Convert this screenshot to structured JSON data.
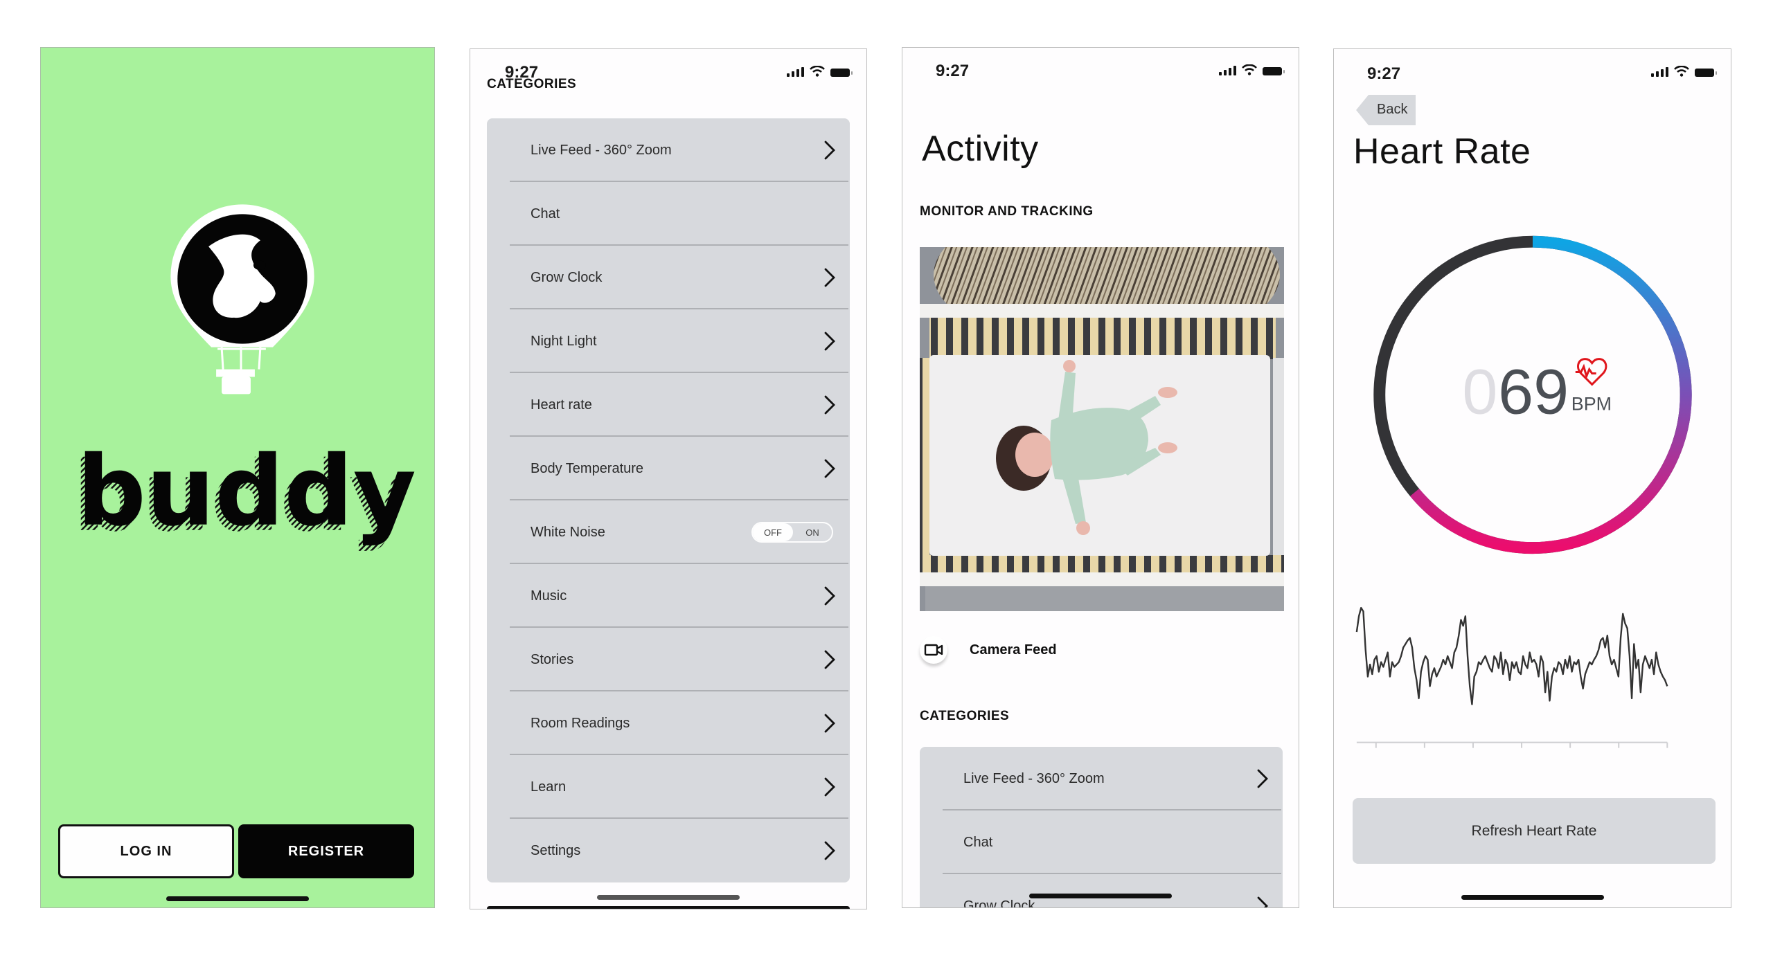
{
  "status_bar": {
    "time": "9:27"
  },
  "screens": {
    "welcome": {
      "brand": "buddy",
      "login_label": "LOG IN",
      "register_label": "REGISTER",
      "bg_color": "#a8f29c"
    },
    "categories": {
      "title": "CATEGORIES",
      "items": [
        {
          "label": "Live Feed - 360° Zoom",
          "control": "chevron"
        },
        {
          "label": "Chat",
          "control": "none"
        },
        {
          "label": "Grow Clock",
          "control": "chevron"
        },
        {
          "label": "Night Light",
          "control": "chevron"
        },
        {
          "label": "Heart rate",
          "control": "chevron"
        },
        {
          "label": "Body Temperature",
          "control": "chevron"
        },
        {
          "label": "White Noise",
          "control": "toggle",
          "toggle": {
            "off_label": "OFF",
            "on_label": "ON",
            "state": "off"
          }
        },
        {
          "label": "Music",
          "control": "chevron"
        },
        {
          "label": "Stories",
          "control": "chevron"
        },
        {
          "label": "Room Readings",
          "control": "chevron"
        },
        {
          "label": "Learn",
          "control": "chevron"
        },
        {
          "label": "Settings",
          "control": "chevron"
        }
      ]
    },
    "activity": {
      "title": "Activity",
      "monitor_heading": "MONITOR AND TRACKING",
      "camera_feed_label": "Camera Feed",
      "camera_icon": "video-camera-icon",
      "categories_heading": "CATEGORIES",
      "items": [
        {
          "label": "Live Feed - 360° Zoom",
          "control": "chevron"
        },
        {
          "label": "Chat",
          "control": "none"
        },
        {
          "label": "Grow Clock",
          "control": "chevron"
        }
      ]
    },
    "heart_rate": {
      "back_label": "Back",
      "title": "Heart Rate",
      "bpm_leading": "0",
      "bpm_value": "69",
      "bpm_unit": "BPM",
      "gauge_fraction": 0.64,
      "gauge_colors": {
        "start": "#0ea5e4",
        "mid": "#7b4fb6",
        "end": "#ec0d6d",
        "track": "#333336"
      },
      "refresh_label": "Refresh Heart Rate"
    }
  },
  "chart_data": {
    "type": "line",
    "title": "",
    "xlabel": "",
    "ylabel": "",
    "x_ticks": 7,
    "ylim": [
      0,
      100
    ],
    "grid": false,
    "series": [
      {
        "name": "heart-rate-waveform",
        "color": "#333333",
        "values": [
          75,
          88,
          95,
          92,
          60,
          38,
          48,
          40,
          52,
          55,
          42,
          50,
          46,
          52,
          58,
          38,
          50,
          46,
          48,
          50,
          55,
          62,
          65,
          68,
          70,
          62,
          45,
          35,
          20,
          42,
          50,
          55,
          52,
          30,
          40,
          45,
          38,
          42,
          46,
          52,
          48,
          55,
          50,
          45,
          58,
          62,
          72,
          85,
          80,
          88,
          55,
          30,
          15,
          38,
          42,
          50,
          48,
          52,
          55,
          50,
          45,
          42,
          55,
          52,
          45,
          58,
          40,
          52,
          48,
          35,
          50,
          45,
          50,
          42,
          40,
          55,
          48,
          45,
          58,
          50,
          52,
          48,
          38,
          55,
          50,
          25,
          42,
          18,
          38,
          45,
          42,
          50,
          48,
          40,
          52,
          45,
          55,
          42,
          50,
          48,
          52,
          38,
          28,
          40,
          45,
          50,
          48,
          52,
          55,
          60,
          68,
          70,
          62,
          72,
          55,
          48,
          52,
          45,
          38,
          70,
          90,
          82,
          78,
          55,
          20,
          65,
          45,
          52,
          25,
          48,
          55,
          50,
          45,
          52,
          40,
          58,
          48,
          42,
          38,
          35,
          30
        ]
      }
    ]
  }
}
